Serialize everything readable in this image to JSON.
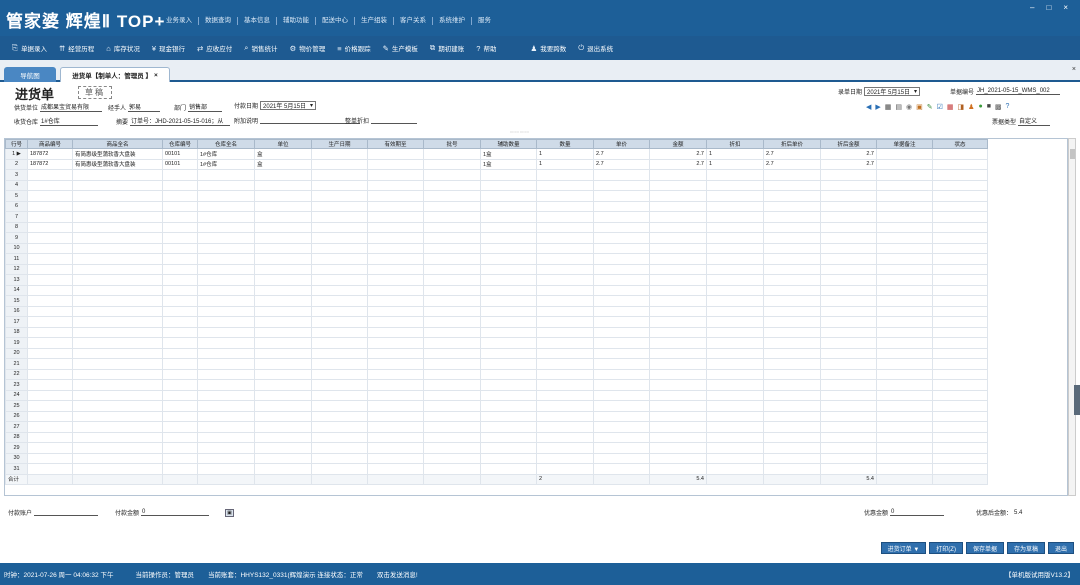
{
  "app": {
    "logo": "管家婆 辉煌Ⅱ TOP+"
  },
  "window": {
    "min": "–",
    "max": "□",
    "close": "×"
  },
  "menu": [
    "业务录入",
    "数据查询",
    "基本信息",
    "辅助功能",
    "配送中心",
    "生产组装",
    "客户关系",
    "系统维护",
    "服务"
  ],
  "toolbar": [
    {
      "icon": "⎘",
      "label": "单据录入"
    },
    {
      "icon": "⇈",
      "label": "经营历程"
    },
    {
      "icon": "⌂",
      "label": "库存状况"
    },
    {
      "icon": "¥",
      "label": "现金银行"
    },
    {
      "icon": "⇄",
      "label": "应收应付"
    },
    {
      "icon": "⌕",
      "label": "销售统计"
    },
    {
      "icon": "⚙",
      "label": "物价管理"
    },
    {
      "icon": "≡",
      "label": "价格跟踪"
    },
    {
      "icon": "✎",
      "label": "生产模板"
    },
    {
      "icon": "⧉",
      "label": "期初建账"
    },
    {
      "icon": "?",
      "label": "帮助"
    },
    {
      "icon": "♟",
      "label": "我要跨数"
    },
    {
      "icon": "⏻",
      "label": "退出系统"
    }
  ],
  "tabs": {
    "nav": "导航图",
    "doc": "进货单【制单人：管理员 】",
    "close": "×"
  },
  "corner_close": "×",
  "form": {
    "title": "进货单",
    "status": "草稿",
    "supplier_label": "供货单位",
    "supplier": "成都果宝贸易有限",
    "handler_label": "经手人",
    "handler": "郭易",
    "dept_label": "部门",
    "dept": "销售部",
    "paydate_label": "付款日期",
    "paydate": "2021年 5月15日",
    "warehouse_label": "收货仓库",
    "warehouse": "1#仓库",
    "summary_label": "摘要",
    "summary": "订单号：JHD-2021-05-15-016；从",
    "extra_label": "附加说明",
    "extra": "",
    "discount_label": "整单折扣",
    "discount": "",
    "recdate_label": "录单日期",
    "recdate": "2021年 5月15日",
    "docno_label": "单据编号",
    "docno": "JH_2021-05-15_WMS_002",
    "doctype_label": "票据类型",
    "doctype": "自定义",
    "split_hint": "::::::::  ::::::::"
  },
  "icons_right": [
    "◀",
    "▶",
    "▦",
    "▤",
    "◉",
    "▣",
    "✎",
    "☑",
    "▦",
    "◨",
    "♟",
    "●",
    "■",
    "▩",
    "?"
  ],
  "grid": {
    "headers": [
      "行号",
      "商品编号",
      "商品全名",
      "仓库编号",
      "仓库全名",
      "单位",
      "生产日期",
      "有效期至",
      "批号",
      "辅助数量",
      "数量",
      "单价",
      "金额",
      "折扣",
      "折后单价",
      "折后金额",
      "单据备注",
      "状态"
    ],
    "rows": [
      [
        "1",
        "187872",
        "有简惠级型蒲软香大盘装",
        "00101",
        "1#仓库",
        "盒",
        "",
        "",
        "",
        "1盒",
        "1",
        "2.7",
        "2.7",
        "1",
        "2.7",
        "2.7",
        "",
        ""
      ],
      [
        "2",
        "187872",
        "有简惠级型蒲软香大盘装",
        "00101",
        "1#仓库",
        "盒",
        "",
        "",
        "",
        "1盒",
        "1",
        "2.7",
        "2.7",
        "1",
        "2.7",
        "2.7",
        "",
        ""
      ]
    ],
    "empty_from": 3,
    "empty_to": 31,
    "total": {
      "label": "合计",
      "qty": "2",
      "amount": "5.4",
      "disc_amount": "5.4"
    }
  },
  "bottom": {
    "account_label": "付款账户",
    "account": "",
    "paid_label": "付款金额",
    "paid": "0",
    "pref_label": "优惠金额",
    "pref": "0",
    "after_label": "优惠后金额：",
    "after": "5.4"
  },
  "buttons": {
    "order": "进货订单 ▼",
    "print": "打印(Z)",
    "save": "保存单据",
    "draft": "存为草稿",
    "exit": "退出"
  },
  "status": {
    "time": "时钟：2021-07-26 周一 04:06:32 下午",
    "operator": "当前操作员：管理员",
    "account": "当前账套：HHYS132_0331(辉煌演示 连接状态：正常",
    "msg": "双击发送消息!",
    "version": "【单机版试用版V13.2】"
  }
}
